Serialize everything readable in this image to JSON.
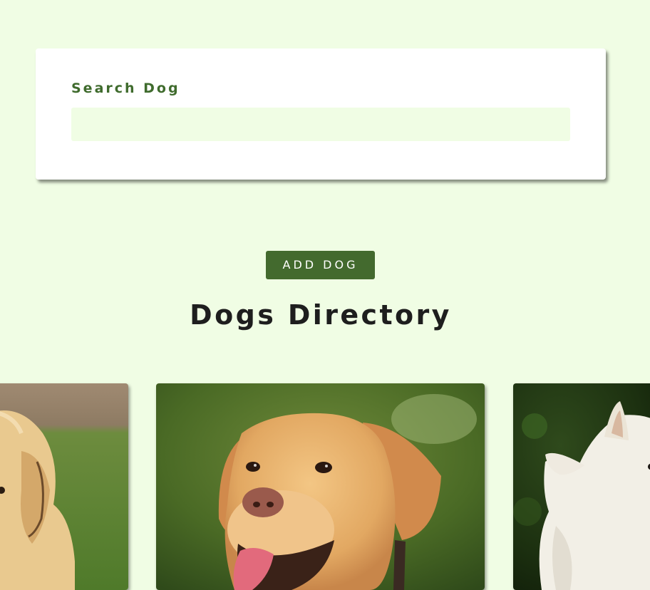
{
  "search": {
    "label": "Search Dog",
    "value": "",
    "placeholder": ""
  },
  "actions": {
    "add_dog_label": "ADD DOG"
  },
  "heading": {
    "title": "Dogs Directory"
  },
  "dogs": [
    {
      "photo": "yellow-labrador-puppy-photo"
    },
    {
      "photo": "golden-labrador-photo"
    },
    {
      "photo": "west-highland-terrier-photo"
    }
  ],
  "colors": {
    "page_background": "#f0fde4",
    "accent_green": "#436a2e",
    "label_green": "#3f6b2d",
    "card_background": "#ffffff",
    "title_text": "#1e1e1e"
  }
}
